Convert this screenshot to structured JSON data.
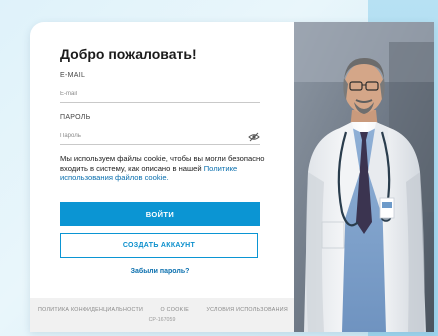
{
  "login": {
    "title": "Добро пожаловать!",
    "email_label": "E-MAIL",
    "email_placeholder": "E-mail",
    "password_label": "ПАРОЛЬ",
    "password_placeholder": "Пароль",
    "password_toggle_icon": "eye-slash-icon",
    "cookie_text": "Мы используем файлы cookie, чтобы вы могли безопасно входить в систему, как описано в нашей",
    "cookie_link": "Политике использования файлов cookie.",
    "login_button": "ВОЙТИ",
    "create_button": "СОЗДАТЬ АККАУНТ",
    "forgot_link": "Забыли пароль?"
  },
  "footer": {
    "links": [
      "ПОЛИТИКА КОНФИДЕНЦИАЛЬНОСТИ",
      "О COOKIE",
      "УСЛОВИЯ ИСПОЛЬЗОВАНИЯ"
    ],
    "code": "CP-167059"
  },
  "colors": {
    "accent": "#0b95d3",
    "link": "#0a6fae",
    "background": "#dff2fa"
  }
}
